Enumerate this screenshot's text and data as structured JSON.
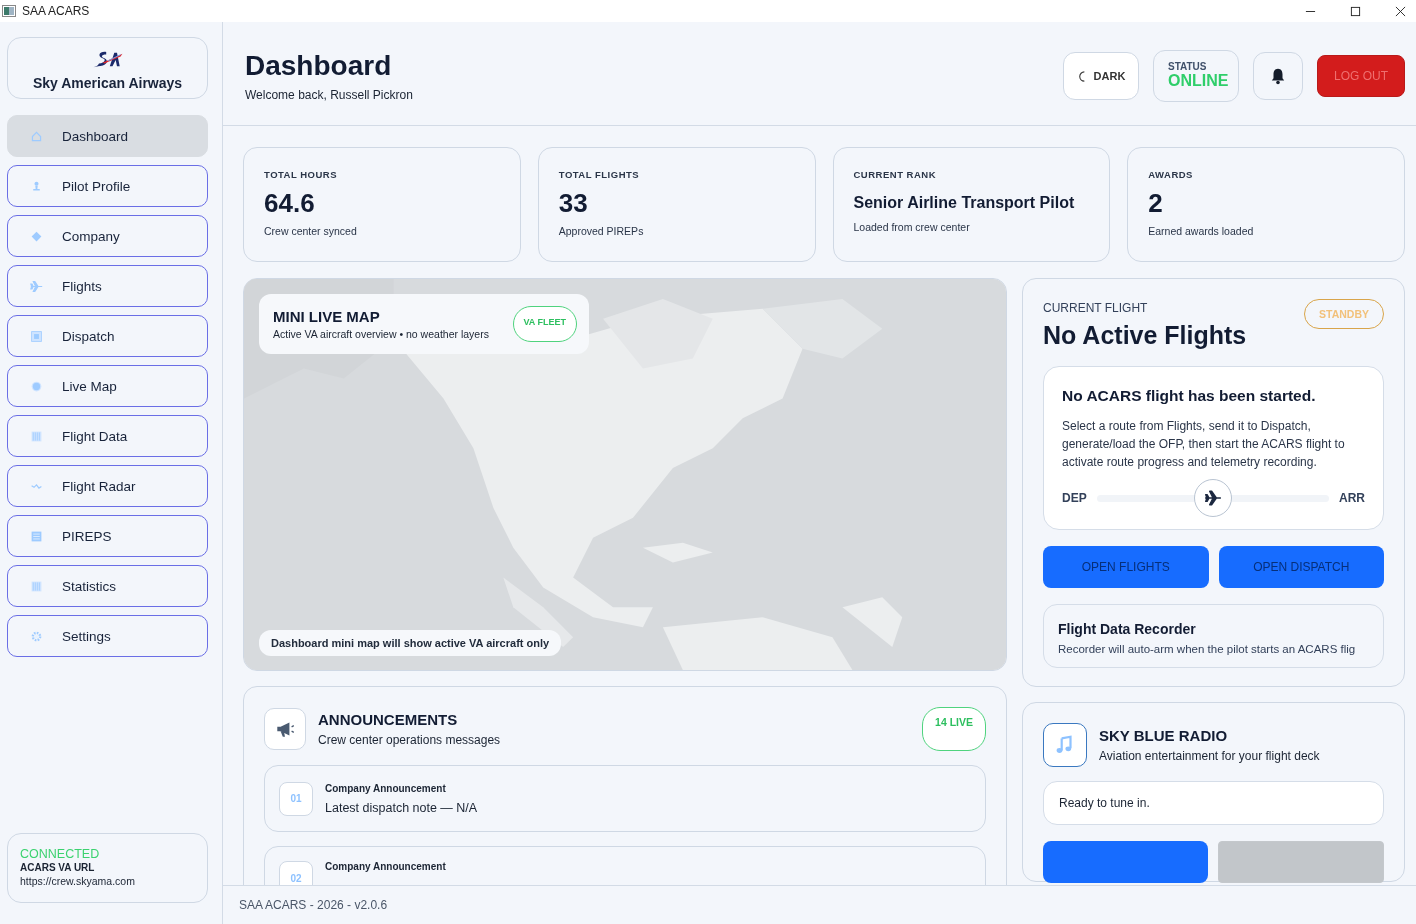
{
  "window": {
    "title": "SAA ACARS"
  },
  "sidebar": {
    "brand": "Sky American Airways",
    "items": [
      {
        "label": "Dashboard",
        "selected": true
      },
      {
        "label": "Pilot Profile",
        "selected": false
      },
      {
        "label": "Company",
        "selected": false
      },
      {
        "label": "Flights",
        "selected": false
      },
      {
        "label": "Dispatch",
        "selected": false
      },
      {
        "label": "Live Map",
        "selected": false
      },
      {
        "label": "Flight Data",
        "selected": false
      },
      {
        "label": "Flight Radar",
        "selected": false
      },
      {
        "label": "PIREPS",
        "selected": false
      },
      {
        "label": "Statistics",
        "selected": false
      },
      {
        "label": "Settings",
        "selected": false
      }
    ],
    "connection": {
      "status": "CONNECTED",
      "label": "ACARS VA URL",
      "url": "https://crew.skyama.com"
    }
  },
  "header": {
    "title": "Dashboard",
    "subtitle": "Welcome back, Russell Pickron",
    "theme_button": "DARK",
    "status": {
      "label": "STATUS",
      "value": "ONLINE"
    },
    "logout": "LOG OUT"
  },
  "stats": [
    {
      "label": "TOTAL HOURS",
      "value": "64.6",
      "note": "Crew center synced",
      "kind": "number"
    },
    {
      "label": "TOTAL FLIGHTS",
      "value": "33",
      "note": "Approved PIREPs",
      "kind": "number"
    },
    {
      "label": "CURRENT RANK",
      "value": "Senior Airline Transport Pilot",
      "note": "Loaded from crew center",
      "kind": "text"
    },
    {
      "label": "AWARDS",
      "value": "2",
      "note": "Earned awards loaded",
      "kind": "number"
    }
  ],
  "map": {
    "title": "MINI LIVE MAP",
    "subtitle": "Active VA aircraft overview • no weather layers",
    "badge": "VA FLEET",
    "caption": "Dashboard mini map will show active VA aircraft only"
  },
  "announcements": {
    "title": "ANNOUNCEMENTS",
    "subtitle": "Crew center operations messages",
    "badge": "14 LIVE",
    "items": [
      {
        "number": "01",
        "title": "Company Announcement",
        "body": "Latest dispatch note — N/A"
      },
      {
        "number": "02",
        "title": "Company Announcement"
      }
    ]
  },
  "current_flight": {
    "label": "CURRENT FLIGHT",
    "title": "No Active Flights",
    "badge": "STANDBY",
    "empty_title": "No ACARS flight has been started.",
    "empty_text": "Select a route from Flights, send it to Dispatch, generate/load the OFP, then start the ACARS flight to activate route progress and telemetry recording.",
    "dep": "DEP",
    "arr": "ARR",
    "buttons": [
      "OPEN FLIGHTS",
      "OPEN DISPATCH"
    ],
    "recorder": {
      "title": "Flight Data Recorder",
      "text": "Recorder will auto-arm when the pilot starts an ACARS flig"
    }
  },
  "radio": {
    "title": "SKY BLUE RADIO",
    "subtitle": "Aviation entertainment for your flight deck",
    "status_text": "Ready to tune in."
  },
  "footer": "SAA ACARS - 2026 - v2.0.6"
}
